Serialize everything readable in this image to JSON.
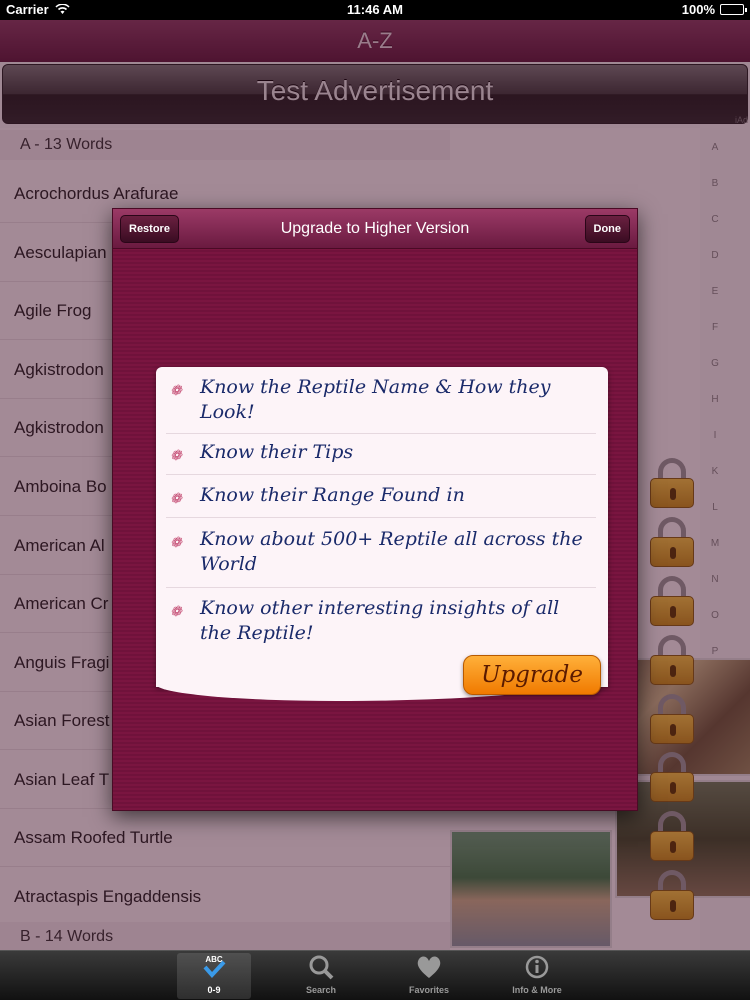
{
  "status_bar": {
    "carrier": "Carrier",
    "time": "11:46 AM",
    "battery": "100%"
  },
  "nav": {
    "title": "A-Z"
  },
  "ad": {
    "text": "Test Advertisement",
    "label": "iAd"
  },
  "list": {
    "sections": [
      {
        "header": "A - 13 Words"
      },
      {
        "header": "B - 14 Words"
      }
    ],
    "rows": [
      "Acrochordus Arafurae",
      "Aesculapian",
      "Agile Frog",
      "Agkistrodon",
      "Agkistrodon",
      "Amboina Bo",
      "American Al",
      "American Cr",
      "Anguis Fragi",
      "Asian Forest",
      "Asian Leaf T",
      "Assam Roofed Turtle",
      "Atractaspis Engaddensis"
    ]
  },
  "index_letters": [
    "A",
    "B",
    "C",
    "D",
    "E",
    "F",
    "G",
    "H",
    "I",
    "K",
    "L",
    "M",
    "N",
    "O",
    "P"
  ],
  "popup": {
    "title": "Upgrade to Higher Version",
    "restore_label": "Restore",
    "done_label": "Done",
    "features": [
      "Know the Reptile Name & How they Look!",
      "Know their Tips",
      "Know their Range Found in",
      "Know about 500+ Reptile all across the World",
      "Know other interesting insights of all the Reptile!"
    ],
    "upgrade_label": "Upgrade"
  },
  "tabs": [
    {
      "label": "0-9",
      "icon": "abc-check-icon",
      "active": true
    },
    {
      "label": "Search",
      "icon": "search-icon",
      "active": false
    },
    {
      "label": "Favorites",
      "icon": "heart-icon",
      "active": false
    },
    {
      "label": "Info & More",
      "icon": "info-icon",
      "active": false
    }
  ],
  "colors": {
    "nav": "#6e2248",
    "popup": "#751440",
    "upgrade": "#f59a20"
  }
}
